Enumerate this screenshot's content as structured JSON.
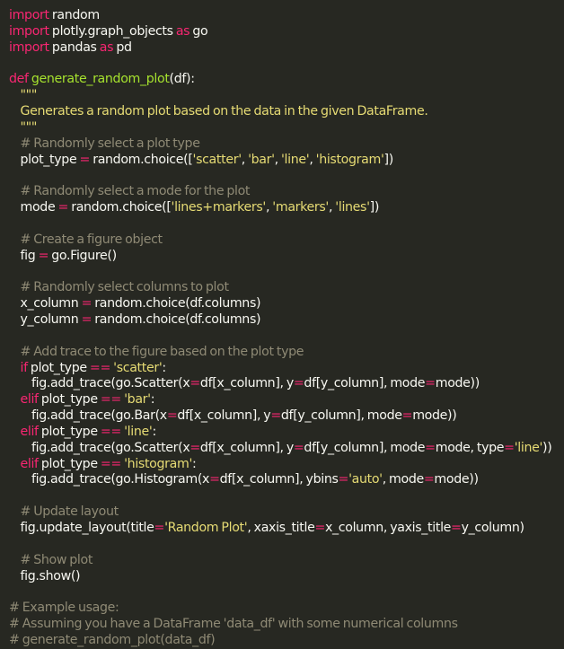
{
  "editor": {
    "theme_colors": {
      "background": "#272822",
      "text": "#f8f8f2",
      "keyword": "#f92672",
      "function": "#a6e22e",
      "string": "#e6db74",
      "comment": "#8f8a75"
    },
    "lines": [
      {
        "indent": 0,
        "tokens": [
          {
            "t": "import",
            "k": "kw"
          },
          {
            "t": " random",
            "k": "tx"
          }
        ]
      },
      {
        "indent": 0,
        "tokens": [
          {
            "t": "import",
            "k": "kw"
          },
          {
            "t": " plotly.graph_objects ",
            "k": "tx"
          },
          {
            "t": "as",
            "k": "kw"
          },
          {
            "t": " go",
            "k": "tx"
          }
        ]
      },
      {
        "indent": 0,
        "tokens": [
          {
            "t": "import",
            "k": "kw"
          },
          {
            "t": " pandas ",
            "k": "tx"
          },
          {
            "t": "as",
            "k": "kw"
          },
          {
            "t": " pd",
            "k": "tx"
          }
        ]
      },
      {
        "indent": 0,
        "tokens": []
      },
      {
        "indent": 0,
        "tokens": [
          {
            "t": "def",
            "k": "kw"
          },
          {
            "t": " ",
            "k": "tx"
          },
          {
            "t": "generate_random_plot",
            "k": "fn"
          },
          {
            "t": "(df):",
            "k": "tx"
          }
        ]
      },
      {
        "indent": 1,
        "tokens": [
          {
            "t": "\"\"\"",
            "k": "str"
          }
        ]
      },
      {
        "indent": 1,
        "tokens": [
          {
            "t": "Generates a random plot based on the data in the given DataFrame.",
            "k": "str"
          }
        ]
      },
      {
        "indent": 1,
        "tokens": [
          {
            "t": "\"\"\"",
            "k": "str"
          }
        ]
      },
      {
        "indent": 1,
        "tokens": [
          {
            "t": "# Randomly select a plot type",
            "k": "cm"
          }
        ]
      },
      {
        "indent": 1,
        "tokens": [
          {
            "t": "plot_type ",
            "k": "tx"
          },
          {
            "t": "=",
            "k": "kw"
          },
          {
            "t": " random.choice([",
            "k": "tx"
          },
          {
            "t": "'scatter'",
            "k": "str"
          },
          {
            "t": ", ",
            "k": "tx"
          },
          {
            "t": "'bar'",
            "k": "str"
          },
          {
            "t": ", ",
            "k": "tx"
          },
          {
            "t": "'line'",
            "k": "str"
          },
          {
            "t": ", ",
            "k": "tx"
          },
          {
            "t": "'histogram'",
            "k": "str"
          },
          {
            "t": "])",
            "k": "tx"
          }
        ]
      },
      {
        "indent": 0,
        "tokens": []
      },
      {
        "indent": 1,
        "tokens": [
          {
            "t": "# Randomly select a mode for the plot",
            "k": "cm"
          }
        ]
      },
      {
        "indent": 1,
        "tokens": [
          {
            "t": "mode ",
            "k": "tx"
          },
          {
            "t": "=",
            "k": "kw"
          },
          {
            "t": " random.choice([",
            "k": "tx"
          },
          {
            "t": "'lines+markers'",
            "k": "str"
          },
          {
            "t": ", ",
            "k": "tx"
          },
          {
            "t": "'markers'",
            "k": "str"
          },
          {
            "t": ", ",
            "k": "tx"
          },
          {
            "t": "'lines'",
            "k": "str"
          },
          {
            "t": "])",
            "k": "tx"
          }
        ]
      },
      {
        "indent": 0,
        "tokens": []
      },
      {
        "indent": 1,
        "tokens": [
          {
            "t": "# Create a figure object",
            "k": "cm"
          }
        ]
      },
      {
        "indent": 1,
        "tokens": [
          {
            "t": "fig ",
            "k": "tx"
          },
          {
            "t": "=",
            "k": "kw"
          },
          {
            "t": " go.Figure()",
            "k": "tx"
          }
        ]
      },
      {
        "indent": 0,
        "tokens": []
      },
      {
        "indent": 1,
        "tokens": [
          {
            "t": "# Randomly select columns to plot",
            "k": "cm"
          }
        ]
      },
      {
        "indent": 1,
        "tokens": [
          {
            "t": "x_column ",
            "k": "tx"
          },
          {
            "t": "=",
            "k": "kw"
          },
          {
            "t": " random.choice(df.columns)",
            "k": "tx"
          }
        ]
      },
      {
        "indent": 1,
        "tokens": [
          {
            "t": "y_column ",
            "k": "tx"
          },
          {
            "t": "=",
            "k": "kw"
          },
          {
            "t": " random.choice(df.columns)",
            "k": "tx"
          }
        ]
      },
      {
        "indent": 0,
        "tokens": []
      },
      {
        "indent": 1,
        "tokens": [
          {
            "t": "# Add trace to the figure based on the plot type",
            "k": "cm"
          }
        ]
      },
      {
        "indent": 1,
        "tokens": [
          {
            "t": "if",
            "k": "kw"
          },
          {
            "t": " plot_type ",
            "k": "tx"
          },
          {
            "t": "==",
            "k": "kw"
          },
          {
            "t": " ",
            "k": "tx"
          },
          {
            "t": "'scatter'",
            "k": "str"
          },
          {
            "t": ":",
            "k": "tx"
          }
        ]
      },
      {
        "indent": 2,
        "tokens": [
          {
            "t": "fig.add_trace(go.Scatter(x",
            "k": "tx"
          },
          {
            "t": "=",
            "k": "kw"
          },
          {
            "t": "df[x_column], y",
            "k": "tx"
          },
          {
            "t": "=",
            "k": "kw"
          },
          {
            "t": "df[y_column], mode",
            "k": "tx"
          },
          {
            "t": "=",
            "k": "kw"
          },
          {
            "t": "mode))",
            "k": "tx"
          }
        ]
      },
      {
        "indent": 1,
        "tokens": [
          {
            "t": "elif",
            "k": "kw"
          },
          {
            "t": " plot_type ",
            "k": "tx"
          },
          {
            "t": "==",
            "k": "kw"
          },
          {
            "t": " ",
            "k": "tx"
          },
          {
            "t": "'bar'",
            "k": "str"
          },
          {
            "t": ":",
            "k": "tx"
          }
        ]
      },
      {
        "indent": 2,
        "tokens": [
          {
            "t": "fig.add_trace(go.Bar(x",
            "k": "tx"
          },
          {
            "t": "=",
            "k": "kw"
          },
          {
            "t": "df[x_column], y",
            "k": "tx"
          },
          {
            "t": "=",
            "k": "kw"
          },
          {
            "t": "df[y_column], mode",
            "k": "tx"
          },
          {
            "t": "=",
            "k": "kw"
          },
          {
            "t": "mode))",
            "k": "tx"
          }
        ]
      },
      {
        "indent": 1,
        "tokens": [
          {
            "t": "elif",
            "k": "kw"
          },
          {
            "t": " plot_type ",
            "k": "tx"
          },
          {
            "t": "==",
            "k": "kw"
          },
          {
            "t": " ",
            "k": "tx"
          },
          {
            "t": "'line'",
            "k": "str"
          },
          {
            "t": ":",
            "k": "tx"
          }
        ]
      },
      {
        "indent": 2,
        "tokens": [
          {
            "t": "fig.add_trace(go.Scatter(x",
            "k": "tx"
          },
          {
            "t": "=",
            "k": "kw"
          },
          {
            "t": "df[x_column], y",
            "k": "tx"
          },
          {
            "t": "=",
            "k": "kw"
          },
          {
            "t": "df[y_column], mode",
            "k": "tx"
          },
          {
            "t": "=",
            "k": "kw"
          },
          {
            "t": "mode, type",
            "k": "tx"
          },
          {
            "t": "=",
            "k": "kw"
          },
          {
            "t": "'line'",
            "k": "str"
          },
          {
            "t": "))",
            "k": "tx"
          }
        ]
      },
      {
        "indent": 1,
        "tokens": [
          {
            "t": "elif",
            "k": "kw"
          },
          {
            "t": " plot_type ",
            "k": "tx"
          },
          {
            "t": "==",
            "k": "kw"
          },
          {
            "t": " ",
            "k": "tx"
          },
          {
            "t": "'histogram'",
            "k": "str"
          },
          {
            "t": ":",
            "k": "tx"
          }
        ]
      },
      {
        "indent": 2,
        "tokens": [
          {
            "t": "fig.add_trace(go.Histogram(x",
            "k": "tx"
          },
          {
            "t": "=",
            "k": "kw"
          },
          {
            "t": "df[x_column], ybins",
            "k": "tx"
          },
          {
            "t": "=",
            "k": "kw"
          },
          {
            "t": "'auto'",
            "k": "str"
          },
          {
            "t": ", mode",
            "k": "tx"
          },
          {
            "t": "=",
            "k": "kw"
          },
          {
            "t": "mode))",
            "k": "tx"
          }
        ]
      },
      {
        "indent": 0,
        "tokens": []
      },
      {
        "indent": 1,
        "tokens": [
          {
            "t": "# Update layout",
            "k": "cm"
          }
        ]
      },
      {
        "indent": 1,
        "tokens": [
          {
            "t": "fig.update_layout(title",
            "k": "tx"
          },
          {
            "t": "=",
            "k": "kw"
          },
          {
            "t": "'Random Plot'",
            "k": "str"
          },
          {
            "t": ", xaxis_title",
            "k": "tx"
          },
          {
            "t": "=",
            "k": "kw"
          },
          {
            "t": "x_column, yaxis_title",
            "k": "tx"
          },
          {
            "t": "=",
            "k": "kw"
          },
          {
            "t": "y_column)",
            "k": "tx"
          }
        ]
      },
      {
        "indent": 0,
        "tokens": []
      },
      {
        "indent": 1,
        "tokens": [
          {
            "t": "# Show plot",
            "k": "cm"
          }
        ]
      },
      {
        "indent": 1,
        "tokens": [
          {
            "t": "fig.show()",
            "k": "tx"
          }
        ]
      },
      {
        "indent": 0,
        "tokens": []
      },
      {
        "indent": 0,
        "tokens": [
          {
            "t": "# Example usage:",
            "k": "cm"
          }
        ]
      },
      {
        "indent": 0,
        "tokens": [
          {
            "t": "# Assuming you have a DataFrame 'data_df' with some numerical columns",
            "k": "cm"
          }
        ]
      },
      {
        "indent": 0,
        "tokens": [
          {
            "t": "# generate_random_plot(data_df)",
            "k": "cm"
          }
        ]
      }
    ]
  }
}
